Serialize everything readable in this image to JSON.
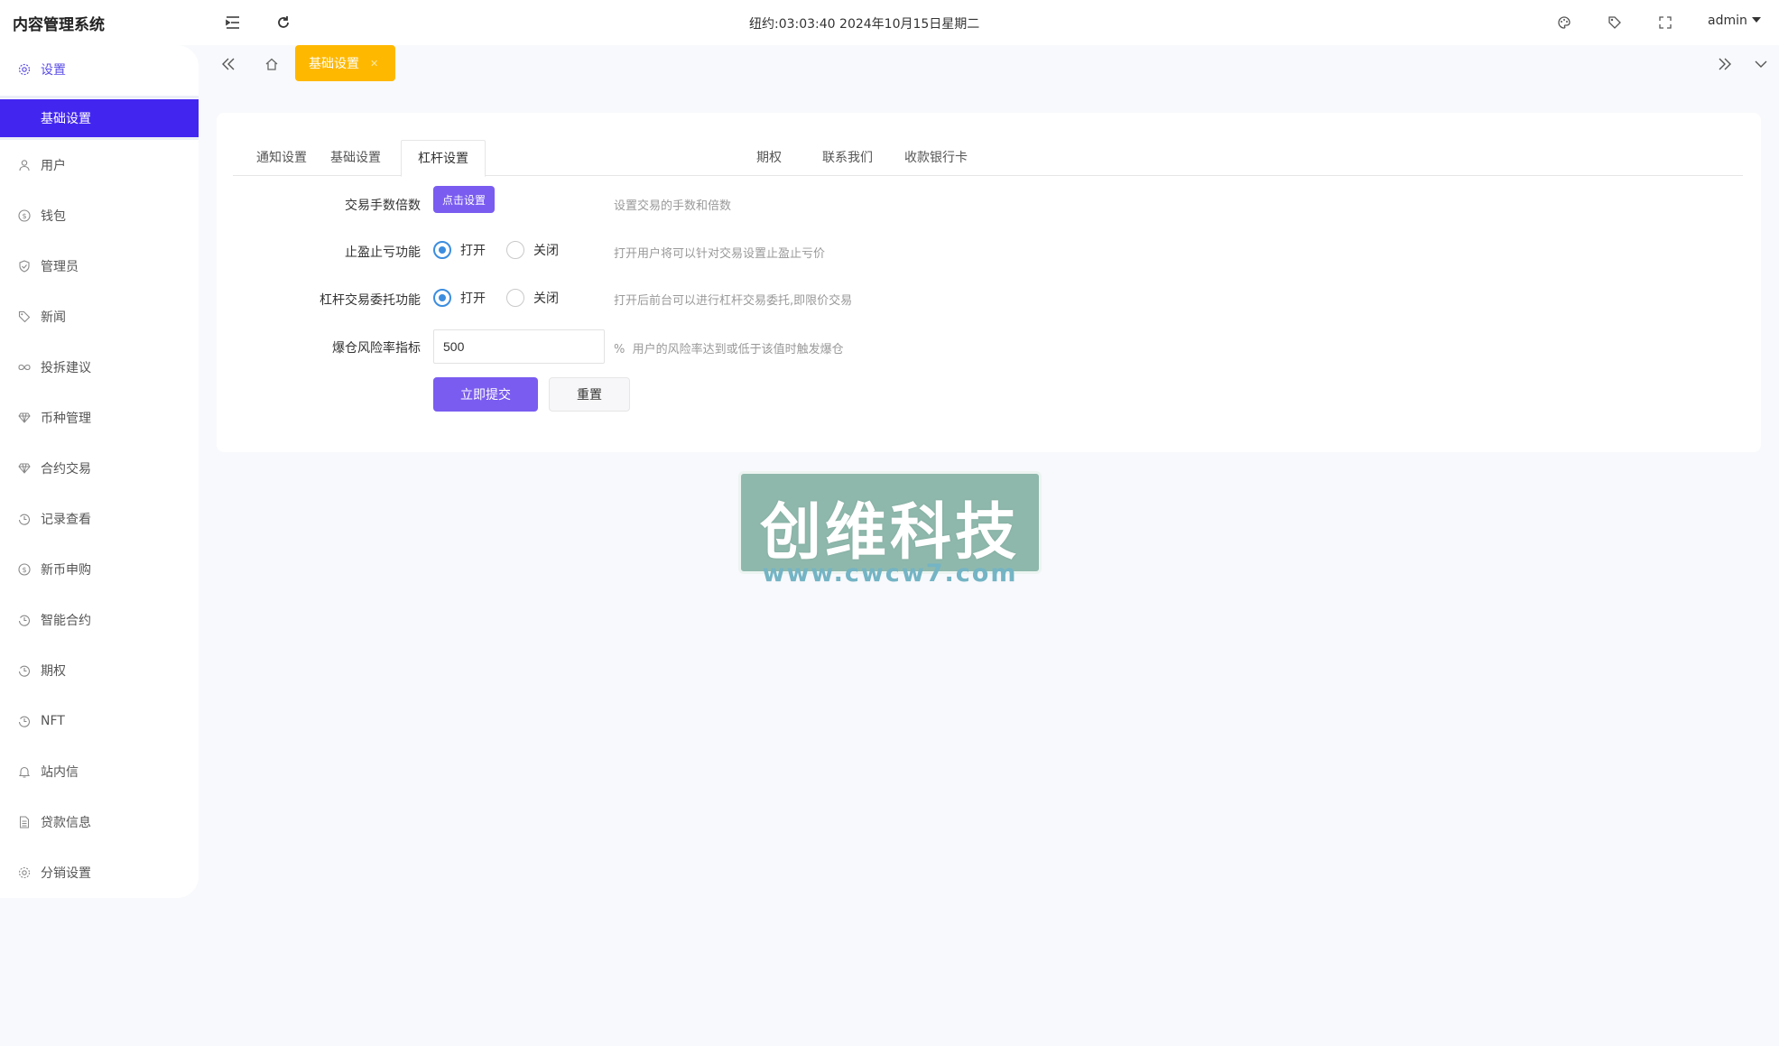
{
  "app": {
    "title": "内容管理系统"
  },
  "header": {
    "clock": "纽约:03:03:40 2024年10月15日星期二",
    "user": "admin",
    "icons": [
      "menu-fold-icon",
      "refresh-icon",
      "theme-icon",
      "tag-icon",
      "fullscreen-icon"
    ]
  },
  "sidebar": {
    "parent": {
      "label": "设置",
      "icon": "gear-icon"
    },
    "active_sub": "基础设置",
    "items": [
      {
        "label": "用户",
        "icon": "user-icon"
      },
      {
        "label": "钱包",
        "icon": "dollar-icon"
      },
      {
        "label": "管理员",
        "icon": "shield-icon"
      },
      {
        "label": "新闻",
        "icon": "tag-icon"
      },
      {
        "label": "投拆建议",
        "icon": "link-icon"
      },
      {
        "label": "币种管理",
        "icon": "diamond-icon"
      },
      {
        "label": "合约交易",
        "icon": "diamond-icon"
      },
      {
        "label": "记录查看",
        "icon": "history-icon"
      },
      {
        "label": "新币申购",
        "icon": "dollar-icon"
      },
      {
        "label": "智能合约",
        "icon": "history-icon"
      },
      {
        "label": "期权",
        "icon": "history-icon"
      },
      {
        "label": "NFT",
        "icon": "history-icon"
      },
      {
        "label": "站内信",
        "icon": "bell-icon"
      },
      {
        "label": "贷款信息",
        "icon": "document-icon"
      },
      {
        "label": "分销设置",
        "icon": "gear-icon"
      }
    ]
  },
  "tabsbar": {
    "current_tab": "基础设置"
  },
  "card": {
    "tabs": [
      {
        "label": "通知设置",
        "active": false
      },
      {
        "label": "基础设置",
        "active": false
      },
      {
        "label": "杠杆设置",
        "active": true
      },
      {
        "label": "期权",
        "active": false
      },
      {
        "label": "联系我们",
        "active": false
      },
      {
        "label": "收款银行卡",
        "active": false
      }
    ],
    "fee": {
      "label": "交易手数倍数",
      "button": "点击设置",
      "hint": "设置交易的手数和倍数"
    },
    "stop": {
      "label": "止盈止亏功能",
      "on": "打开",
      "off": "关闭",
      "selected": "on",
      "hint": "打开用户将可以针对交易设置止盈止亏价"
    },
    "entrust": {
      "label": "杠杆交易委托功能",
      "on": "打开",
      "off": "关闭",
      "selected": "on",
      "hint": "打开后前台可以进行杠杆交易委托,即限价交易"
    },
    "risk": {
      "label": "爆仓风险率指标",
      "value": "500",
      "unit": "%",
      "hint": "用户的风险率达到或低于该值时触发爆仓"
    },
    "submit": "立即提交",
    "reset": "重置"
  },
  "watermark": {
    "title": "创维科技",
    "url": "www.cwcw7.com"
  }
}
